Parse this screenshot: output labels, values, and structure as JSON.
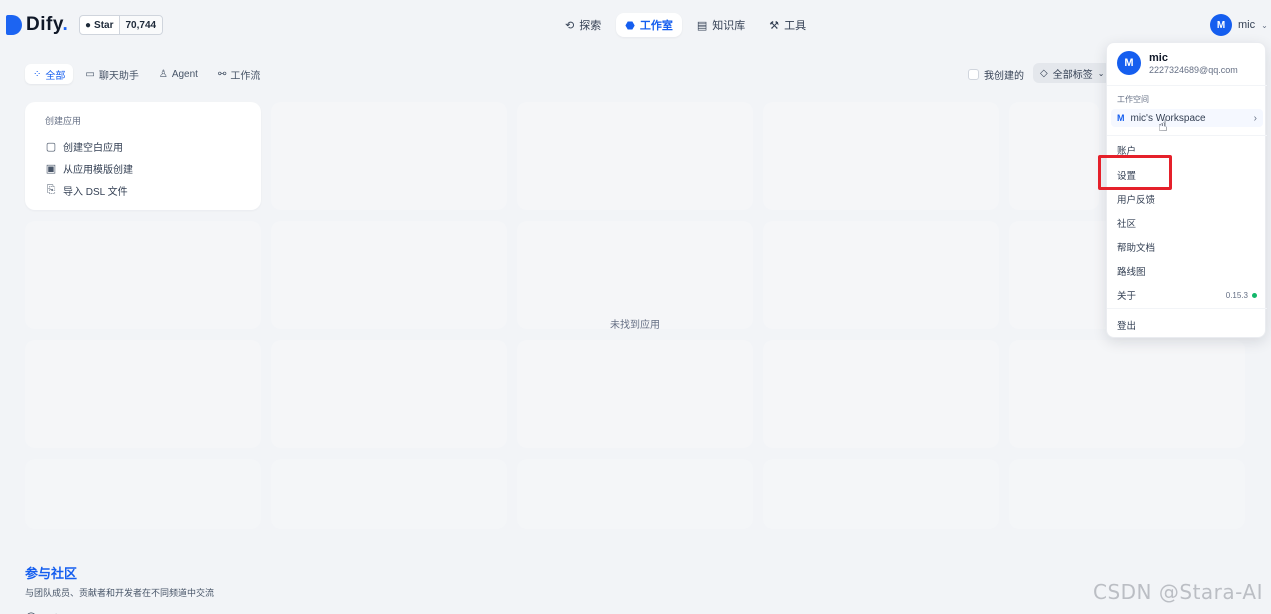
{
  "header": {
    "logo_text": "Dify",
    "logo_dot": ".",
    "github": {
      "star_label": "Star",
      "star_count": "70,744"
    },
    "nav": [
      {
        "label": "探索",
        "icon": "compass-icon"
      },
      {
        "label": "工作室",
        "icon": "robot-icon",
        "active": true
      },
      {
        "label": "知识库",
        "icon": "book-icon"
      },
      {
        "label": "工具",
        "icon": "hammer-icon"
      }
    ],
    "user": {
      "initial": "M",
      "name": "mic"
    }
  },
  "filters": {
    "tabs": [
      {
        "label": "全部",
        "active": true
      },
      {
        "label": "聊天助手"
      },
      {
        "label": "Agent"
      },
      {
        "label": "工作流"
      }
    ],
    "created_by_me": "我创建的",
    "tag_select": "全部标签"
  },
  "create_card": {
    "title": "创建应用",
    "items": [
      "创建空白应用",
      "从应用模版创建",
      "导入 DSL 文件"
    ]
  },
  "empty_state": "未找到应用",
  "community": {
    "title": "参与社区",
    "description": "与团队成员、贡献者和开发者在不同频道中交流"
  },
  "user_menu": {
    "initial": "M",
    "name": "mic",
    "email": "2227324689@qq.com",
    "workspace_section": "工作空间",
    "workspace_initial": "M",
    "workspace_name": "mic's Workspace",
    "items": [
      "账户",
      "设置",
      "用户反馈",
      "社区",
      "帮助文档",
      "路线图",
      "关于"
    ],
    "version": "0.15.3",
    "logout": "登出"
  },
  "watermark": "CSDN @Stara-AI",
  "colors": {
    "accent": "#155eef",
    "highlight": "#e5202a",
    "status_ok": "#12b76a"
  }
}
